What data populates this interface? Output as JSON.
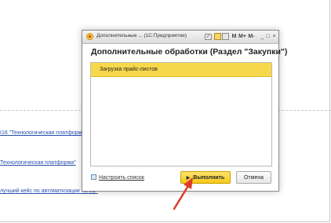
{
  "background": {
    "links": [
      "I16 \"Технологическая платформ",
      "Технологическая платформа\"",
      "лучший кейс по автоматизации на 1С-"
    ]
  },
  "dialog": {
    "window_title": "Дополнительные ... (1С:Предприятие)",
    "toolbar": {
      "m": "M",
      "m_plus": "M+",
      "m_minus": "M-",
      "minimize": "_",
      "maximize": "□",
      "close": "×"
    },
    "heading": "Дополнительные обработки (Раздел \"Закупки\")",
    "list_items": [
      "Загрузка прайс-листов"
    ],
    "settings_link": "Настроить список",
    "run_button": "Выполнить",
    "cancel_button": "Отмена"
  },
  "colors": {
    "accent_yellow": "#f7d84a",
    "annotation_arrow": "#e03a2b",
    "link_blue": "#2a4fb0"
  },
  "icons": [
    "app-1c-icon",
    "checkbox-icon",
    "document-icon",
    "calculator-icon",
    "settings-list-icon",
    "play-icon"
  ]
}
